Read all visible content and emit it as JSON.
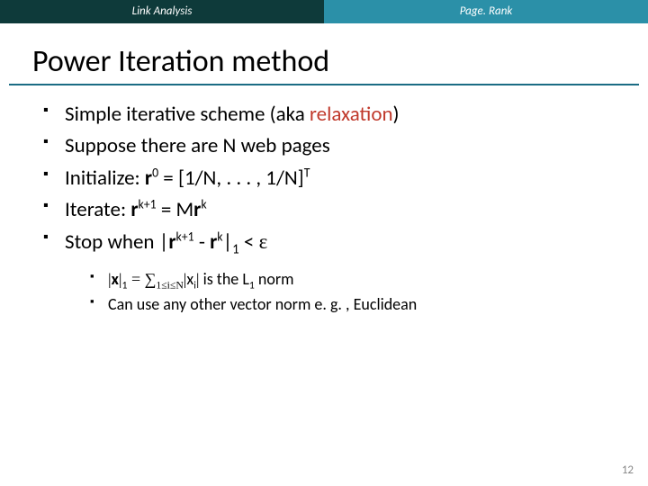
{
  "tabs": {
    "left": "Link Analysis",
    "right": "Page. Rank"
  },
  "title": "Power Iteration method",
  "bullets": {
    "b1_pre": "Simple iterative scheme (aka ",
    "b1_hl": "relaxation",
    "b1_post": ")",
    "b2": "Suppose there are N web pages",
    "b3_pre": "Initialize: ",
    "b3_r": "r",
    "b3_sup0": "0",
    "b3_mid": " = [1/N, . . . , 1/N]",
    "b3_supT": "T",
    "b4_pre": "Iterate: ",
    "b4_r1": "r",
    "b4_sup1": "k+1",
    "b4_eq": " = M",
    "b4_r2": "r",
    "b4_sup2": "k",
    "b5_pre": "Stop when |",
    "b5_r1": "r",
    "b5_sup1": "k+1",
    "b5_mid": " - ",
    "b5_r2": "r",
    "b5_sup2": "k",
    "b5_post": "|",
    "b5_sub1": "1",
    "b5_lt": " < ",
    "b5_eps": "ε"
  },
  "subs": {
    "s1_bar1": "|",
    "s1_x1": "x",
    "s1_bar2": "|",
    "s1_sub1": "1",
    "s1_eqsum": " = ∑",
    "s1_sumsub": "1≤i≤N",
    "s1_bar3": "|",
    "s1_xi": "x",
    "s1_isub": "i",
    "s1_bar4": "|",
    "s1_tail": "  is the L",
    "s1_Lsub": "1",
    "s1_norm": " norm",
    "s2": "Can use any other vector norm e. g. , Euclidean"
  },
  "page_number": "12"
}
